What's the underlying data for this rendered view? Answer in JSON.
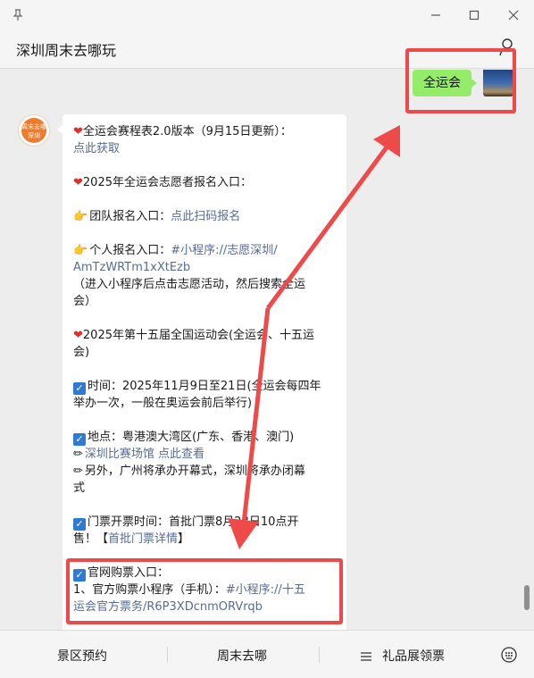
{
  "header": {
    "title": "深圳周末去哪玩"
  },
  "my_message": {
    "text": "全运会"
  },
  "bot_avatar": {
    "line1": "周末去哪",
    "line2": "深圳"
  },
  "message": {
    "l1_text": "全运会赛程表2.0版本（9月15日更新）：",
    "l1_link": "点此获取",
    "l2_text": "2025年全运会志愿者报名入口：",
    "l3_text": "团队报名入口：",
    "l3_link": "点此扫码报名",
    "l4_text": "个人报名入口：",
    "l4_link_a": "#小程序://志愿深圳/",
    "l4_link_b": "AmTzWRTm1xXtEzb",
    "l4_note_a": "（进入小程序后点击志愿活动，然后搜索全运",
    "l4_note_b": "会）",
    "l5_a": "2025年第十五届全国运动会(全运会、十五运",
    "l5_b": "会)",
    "l6_a": "时间：2025年11月9日至21日(全运会每四年",
    "l6_b": "举办一次，一般在奥运会前后举行)",
    "l7_a": "地点：粤港澳大湾区(广东、香港、澳门)",
    "l7_link": "深圳比赛场馆 点此查看",
    "l7_b": "另外，广州将承办开幕式，深圳将承办闭幕",
    "l7_c": "式",
    "l8_a": "门票开票时间：首批门票8月28日10点开",
    "l8_b": "售！【",
    "l8_link": "首批门票详情",
    "l8_end": "】",
    "l9_a": "官网购票入口：",
    "l9_b": "1、官方购票小程序（手机）：",
    "l9_link_a": "#小程序://十五",
    "l9_link_b": "运会官方票务/R6P3XDcnmORVrqb"
  },
  "bottom_menu": [
    "景区预约",
    "周末去哪",
    "礼品展领票"
  ],
  "icons": {
    "pin": "pin-icon",
    "minimize": "minimize-icon",
    "maximize": "maximize-icon",
    "close": "close-icon",
    "person": "person-icon",
    "menu": "menu-icon",
    "keyboard": "keyboard-icon",
    "heart": "heart-icon",
    "point": "pointing-hand-icon",
    "check": "checkbox-icon",
    "pencil": "pencil-icon"
  },
  "colors": {
    "bubble_green": "#95ec69",
    "link": "#576b95",
    "highlight_red": "#ef4a4a"
  }
}
